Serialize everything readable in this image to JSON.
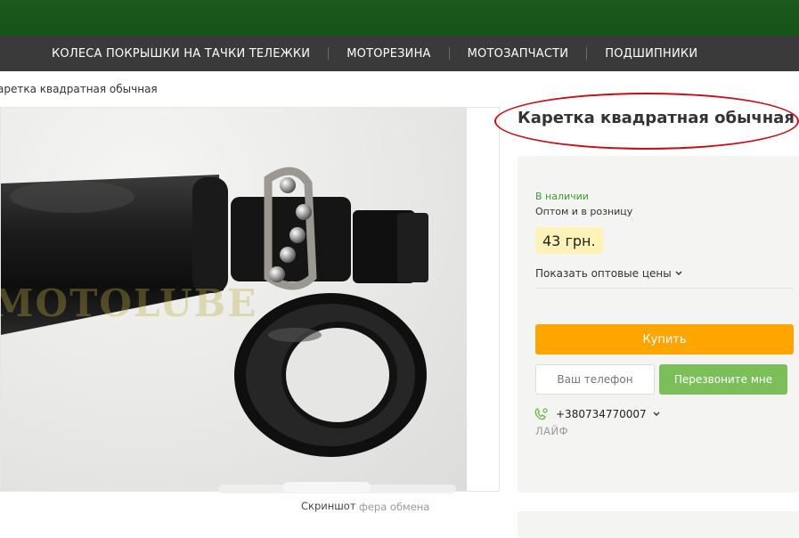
{
  "nav": {
    "items": [
      "КОЛЕСА ПОКРЫШКИ НА ТАЧКИ ТЕЛЕЖКИ",
      "МОТОРЕЗИНА",
      "МОТОЗАПЧАСТИ",
      "ПОДШИПНИКИ"
    ]
  },
  "breadcrumb": {
    "current": "аретка квадратная обычная"
  },
  "photo": {
    "watermark": "MOTOLUBE"
  },
  "product": {
    "title": "Каретка квадратная обычная",
    "availability": "В наличии",
    "sale_type": "Оптом и в розницу",
    "price": "43 грн.",
    "wholesale_link": "Показать оптовые цены",
    "buy_label": "Купить",
    "phone_placeholder": "Ваш телефон",
    "callback_label": "Перезвоните мне",
    "contact_phone": "+380734770007",
    "operator": "ЛАЙФ"
  },
  "overlay": {
    "screenshot_label": "Скриншот",
    "clipboard_label": "фера обмена"
  },
  "colors": {
    "header_green": "#16531a",
    "nav_bg": "#3a3a3a",
    "availability": "#3b9b2f",
    "price_bg": "#fff2b8",
    "buy_button": "#ffa500",
    "callback_button": "#7cbf5a",
    "annotation_ellipse": "#c40e18"
  }
}
